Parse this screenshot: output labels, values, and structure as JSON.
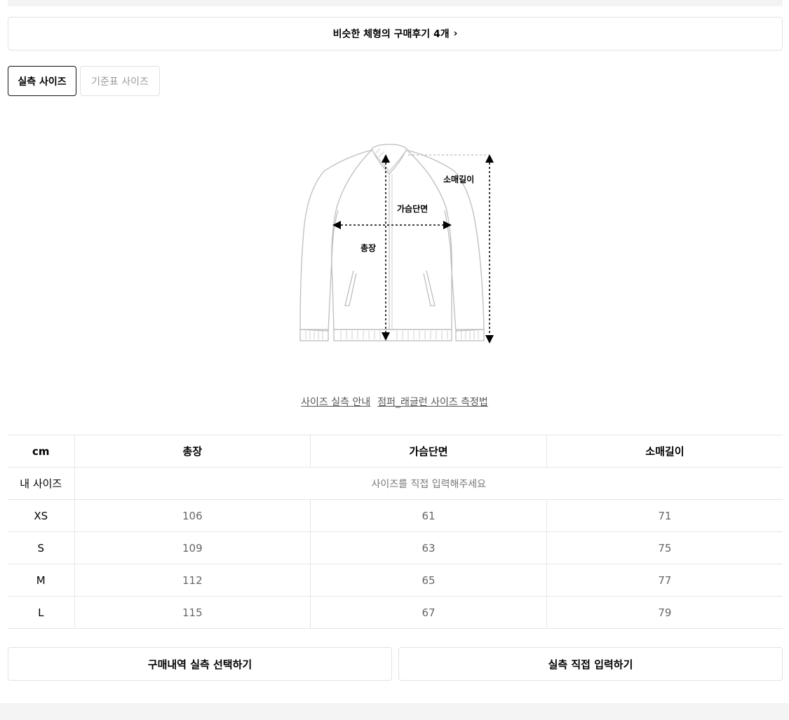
{
  "similar_reviews": {
    "label": "비슷한 체형의 구매후기 4개",
    "chevron": "›"
  },
  "tabs": [
    {
      "label": "실측 사이즈",
      "active": true
    },
    {
      "label": "기준표 사이즈",
      "active": false
    }
  ],
  "diagram": {
    "labels": {
      "sleeve": "소매길이",
      "chest": "가슴단면",
      "length": "총장"
    }
  },
  "guide_links": [
    {
      "label": "사이즈 실측 안내"
    },
    {
      "label": "점퍼_래글런 사이즈 측정법"
    }
  ],
  "size_table": {
    "unit": "cm",
    "columns": [
      "총장",
      "가슴단면",
      "소매길이"
    ],
    "my_size": {
      "label": "내 사이즈",
      "placeholder": "사이즈를 직접 입력해주세요"
    },
    "rows": [
      {
        "size": "XS",
        "values": [
          "106",
          "61",
          "71"
        ]
      },
      {
        "size": "S",
        "values": [
          "109",
          "63",
          "75"
        ]
      },
      {
        "size": "M",
        "values": [
          "112",
          "65",
          "77"
        ]
      },
      {
        "size": "L",
        "values": [
          "115",
          "67",
          "79"
        ]
      }
    ]
  },
  "buttons": {
    "history": "구매내역 실측 선택하기",
    "direct_input": "실측 직접 입력하기"
  }
}
